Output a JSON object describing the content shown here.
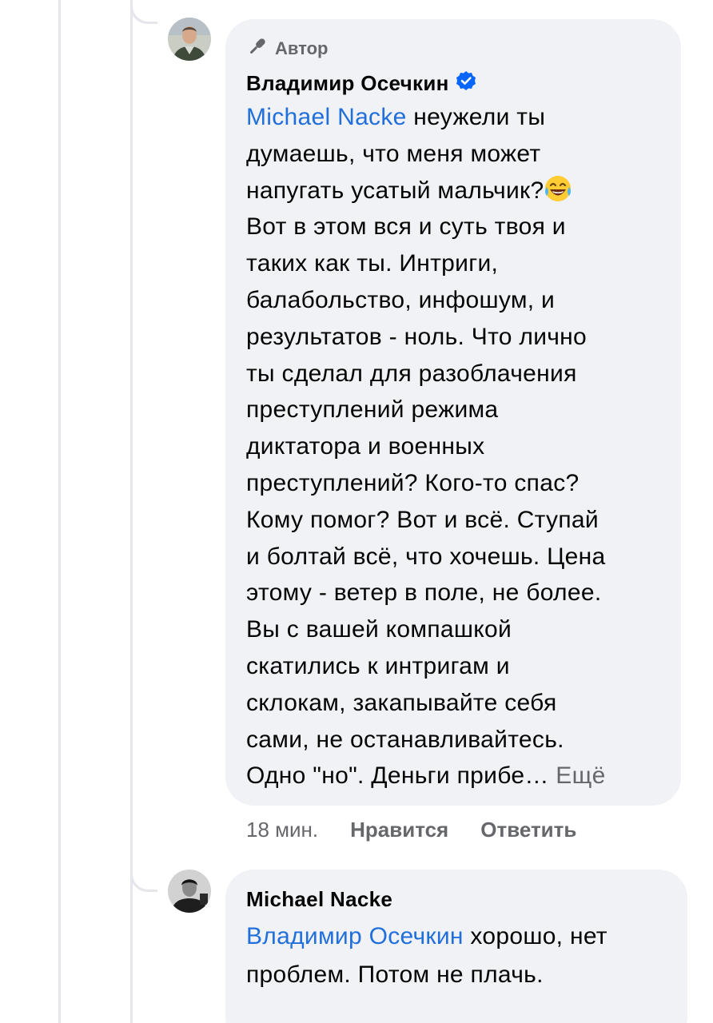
{
  "comment1": {
    "author_badge": "Автор",
    "author_name": "Владимир Осечкин",
    "mention": "Michael Nacke",
    "lines": [
      " неужели ты",
      "думаешь, что меня может",
      "напугать усатый мальчик?",
      "Вот в этом вся и суть твоя и",
      "таких как ты. Интриги,",
      "балабольство, инфошум, и",
      "результатов - ноль. Что лично",
      "ты сделал для разоблачения",
      "преступлений режима",
      "диктатора и военных",
      "преступлений? Кого-то спас?",
      "Кому помог? Вот и всё. Ступай",
      "и болтай всё, что хочешь. Цена",
      "этому - ветер в поле, не более.",
      "Вы с вашей компашкой",
      "скатились к интригам и",
      "склокам, закапывайте себя",
      "сами, не останавливайтесь.",
      "Одно \"но\". Деньги прибе…"
    ],
    "see_more": "Ещё",
    "emoji": "laughing-crying-emoji",
    "time": "18 мин.",
    "like_label": "Нравится",
    "reply_label": "Ответить"
  },
  "comment2": {
    "author_name": "Michael Nacke",
    "mention": "Владимир Осечкин",
    "lines": [
      " хорошо, нет",
      "проблем. Потом не плачь."
    ]
  },
  "colors": {
    "bubble": "#f0f2f5",
    "link": "#216fdb",
    "secondary": "#65676b",
    "verified": "#0866ff",
    "thread_line": "#e4e6eb"
  }
}
